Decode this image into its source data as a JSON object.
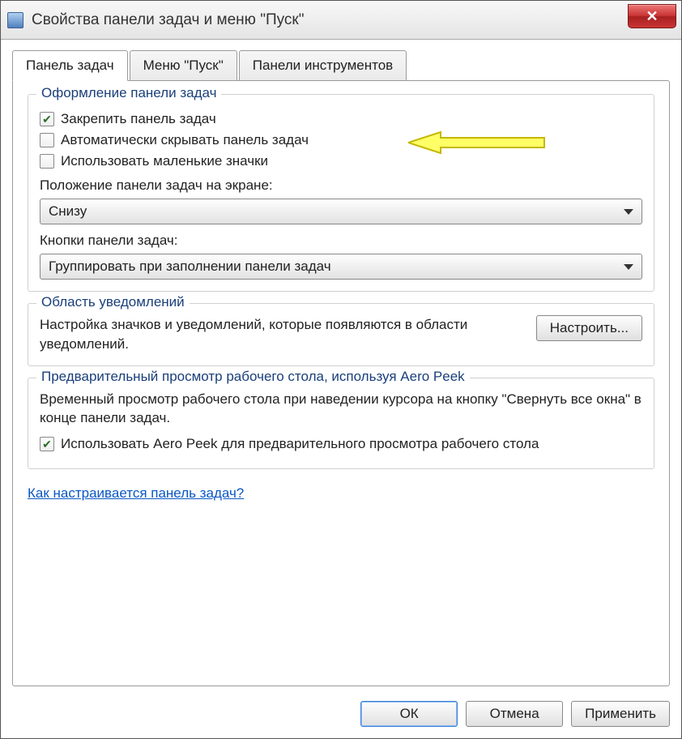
{
  "window": {
    "title": "Свойства панели задач и меню \"Пуск\""
  },
  "tabs": {
    "taskbar": "Панель задач",
    "start": "Меню \"Пуск\"",
    "toolbars": "Панели инструментов"
  },
  "appearance": {
    "legend": "Оформление панели задач",
    "lock": "Закрепить панель задач",
    "autohide": "Автоматически скрывать панель задач",
    "smallicons": "Использовать маленькие значки",
    "position_label": "Положение панели задач на экране:",
    "position_value": "Снизу",
    "buttons_label": "Кнопки панели задач:",
    "buttons_value": "Группировать при заполнении панели задач"
  },
  "notifications": {
    "legend": "Область уведомлений",
    "text": "Настройка значков и уведомлений, которые появляются в области уведомлений.",
    "button": "Настроить..."
  },
  "aero": {
    "legend": "Предварительный просмотр рабочего стола, используя Aero Peek",
    "text": "Временный просмотр рабочего стола при наведении курсора на кнопку \"Свернуть все окна\" в конце панели задач.",
    "checkbox": "Использовать Aero Peek для предварительного просмотра рабочего стола"
  },
  "link": "Как настраивается панель задач?",
  "buttons": {
    "ok": "ОК",
    "cancel": "Отмена",
    "apply": "Применить"
  }
}
